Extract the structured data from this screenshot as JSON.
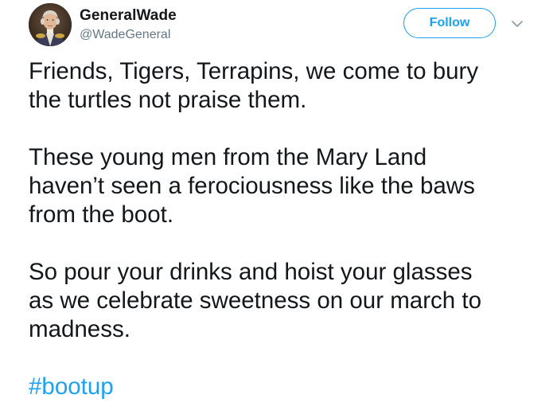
{
  "user": {
    "display_name": "GeneralWade",
    "handle": "@WadeGeneral",
    "avatar_icon": "portrait-avatar"
  },
  "actions": {
    "follow_label": "Follow",
    "menu_icon": "chevron-down-icon"
  },
  "tweet": {
    "paragraphs": [
      [
        "Friends, Tigers, Terrapins, we come to bury",
        "the turtles not praise them."
      ],
      [
        "These young men from the Mary Land",
        "haven’t seen a ferociousness like the baws",
        "from the boot."
      ],
      [
        "So pour your drinks and hoist your glasses",
        "as we celebrate sweetness on our march to",
        "madness."
      ]
    ],
    "hashtag": "#bootup"
  },
  "colors": {
    "accent": "#1da1f2",
    "text": "#14171a",
    "secondary": "#657786"
  }
}
